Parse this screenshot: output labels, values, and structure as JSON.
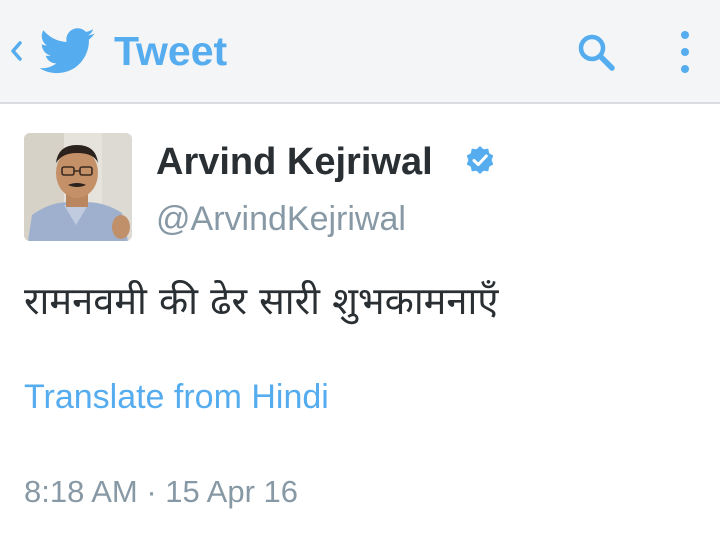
{
  "header": {
    "back_icon": "chevron-left-icon",
    "logo_icon": "twitter-bird-icon",
    "title": "Tweet",
    "search_icon": "search-icon",
    "menu_icon": "overflow-menu-icon",
    "accent_color": "#55acee"
  },
  "tweet": {
    "author": {
      "display_name": "Arvind Kejriwal",
      "handle": "@ArvindKejriwal",
      "verified": true,
      "avatar_icon": "user-avatar"
    },
    "text": "रामनवमी की ढेर सारी शुभकामनाएँ",
    "translate_label": "Translate from Hindi",
    "timestamp": "8:18 AM · 15 Apr 16"
  },
  "colors": {
    "primary_text": "#292f33",
    "secondary_text": "#8899a6",
    "link": "#55acee",
    "verified_badge": "#55acee"
  }
}
